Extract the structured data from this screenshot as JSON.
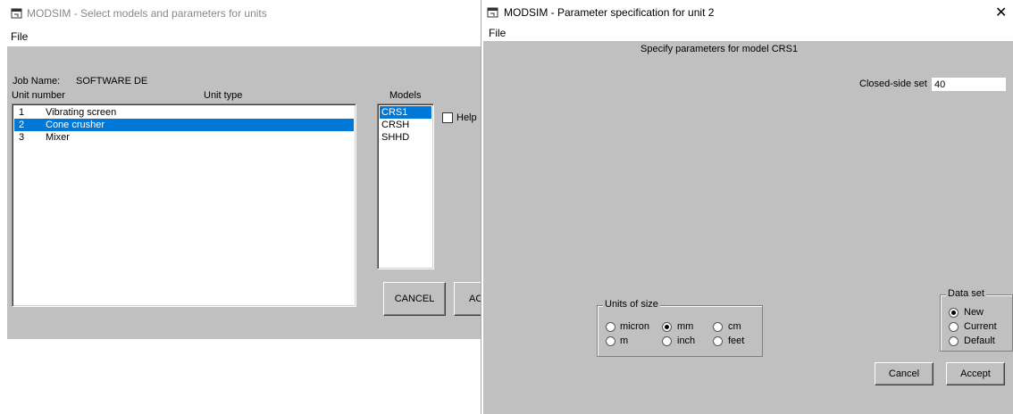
{
  "win1": {
    "title": "MODSIM - Select models and parameters for units",
    "menu": {
      "file": "File"
    },
    "job_name_label": "Job Name:",
    "job_name_value": "SOFTWARE DE",
    "unit_number_header": "Unit number",
    "unit_type_header": "Unit type",
    "models_header": "Models",
    "units": [
      {
        "num": "1",
        "type": "Vibrating screen"
      },
      {
        "num": "2",
        "type": "Cone crusher"
      },
      {
        "num": "3",
        "type": "Mixer"
      }
    ],
    "models": [
      "CRS1",
      "CRSH",
      "SHHD"
    ],
    "help_label": "Help",
    "cancel_label": "CANCEL",
    "accept_label": "AC"
  },
  "win2": {
    "title": "MODSIM - Parameter specification for unit 2",
    "menu": {
      "file": "File"
    },
    "close_glyph": "✕",
    "heading": "Specify parameters for model CRS1",
    "css_label": "Closed-side set",
    "css_value": "40",
    "units_of_size": {
      "title": "Units of size",
      "options": [
        "micron",
        "mm",
        "cm",
        "m",
        "inch",
        "feet"
      ],
      "selected": "mm"
    },
    "data_set": {
      "title": "Data set",
      "options": [
        "New",
        "Current",
        "Default"
      ],
      "selected": "New"
    },
    "cancel_label": "Cancel",
    "accept_label": "Accept"
  },
  "colors": {
    "face": "#c0c0c0",
    "selection": "#0078d7"
  }
}
